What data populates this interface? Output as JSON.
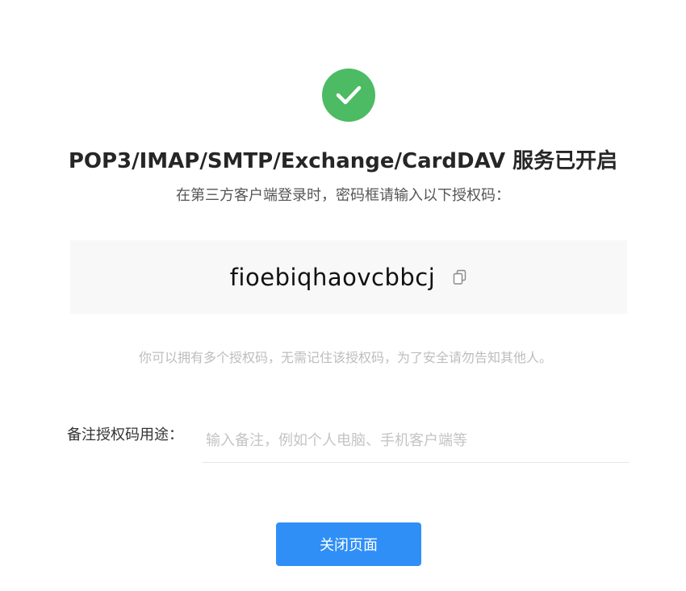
{
  "status": {
    "icon": "check-circle-icon",
    "icon_color": "#4cbb63"
  },
  "title": "POP3/IMAP/SMTP/Exchange/CardDAV 服务已开启",
  "subtitle": "在第三方客户端登录时，密码框请输入以下授权码：",
  "auth_code": {
    "value": "fioebiqhaovcbbcj",
    "copy_icon": "copy-icon"
  },
  "hint": "你可以拥有多个授权码，无需记住该授权码，为了安全请勿告知其他人。",
  "note": {
    "label": "备注授权码用途：",
    "placeholder": "输入备注，例如个人电脑、手机客户端等",
    "value": ""
  },
  "close_button": {
    "label": "关闭页面",
    "color": "#2f8ff7"
  }
}
